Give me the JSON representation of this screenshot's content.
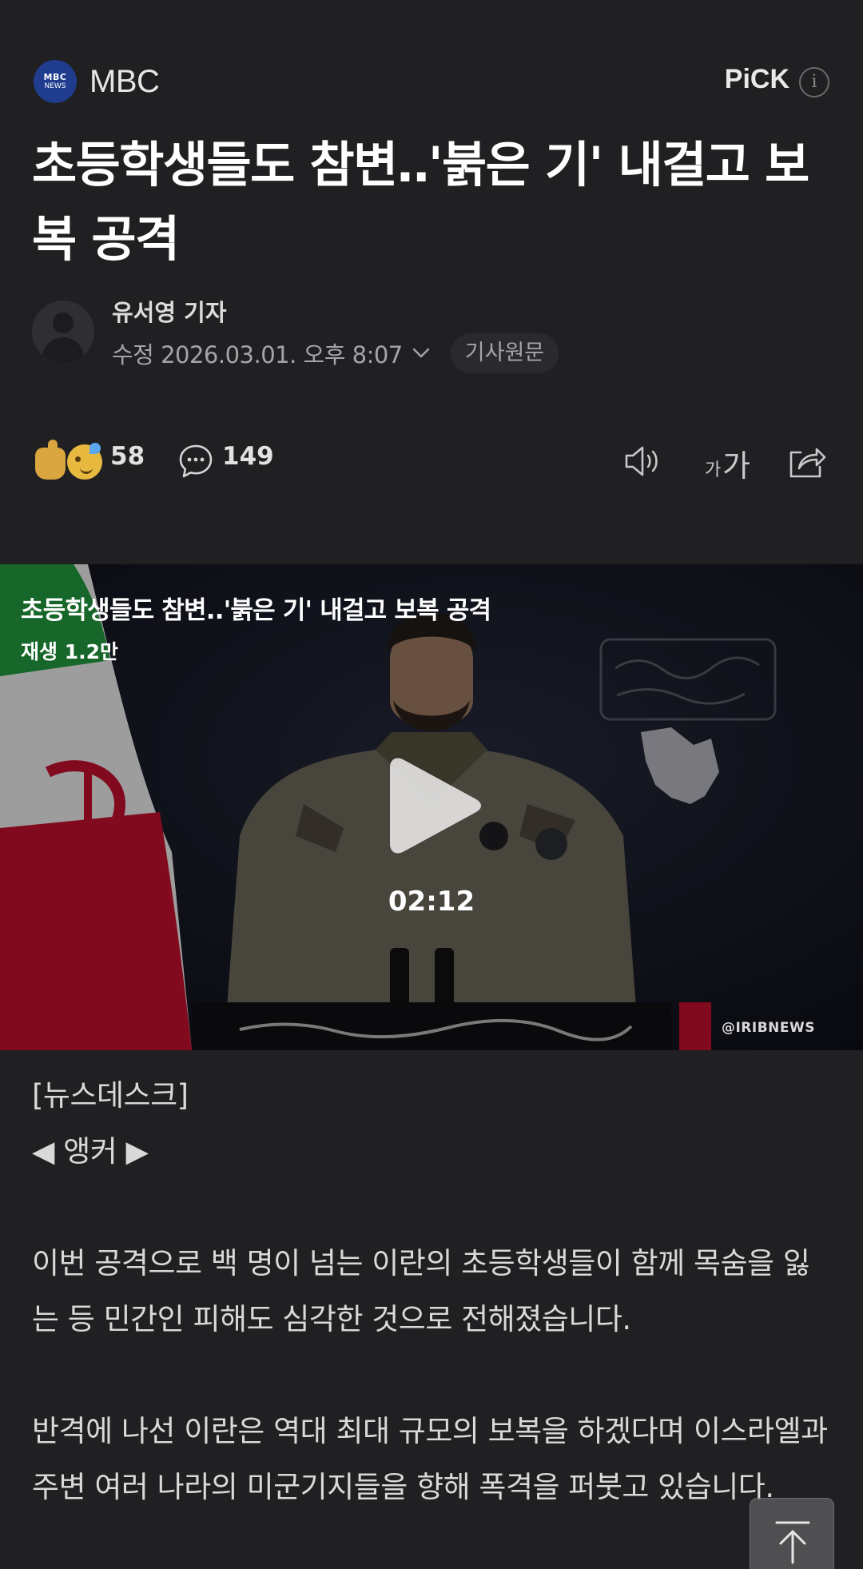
{
  "press": {
    "logo_line1": "MBC",
    "logo_line2": "NEWS",
    "name": "MBC",
    "pick_label": "PiCK",
    "info_label": "i"
  },
  "article": {
    "headline": "초등학생들도 참변‥'붉은 기' 내걸고 보복 공격",
    "reporter": "유서영 기자",
    "date": "수정 2026.03.01. 오후 8:07",
    "origin_button": "기사원문"
  },
  "reactions": {
    "like_count": "58",
    "comment_count": "149",
    "font_small": "가",
    "font_big": "가"
  },
  "video": {
    "title": "초등학생들도 참변..'붉은 기' 내걸고 보복 공격",
    "views": "재생 1.2만",
    "duration": "02:12",
    "watermark": "@IRIBNEWS"
  },
  "body": {
    "line1": "[뉴스데스크]",
    "line2": "◀ 앵커 ▶",
    "para1": "이번 공격으로 백 명이 넘는 이란의 초등학생들이 함께 목숨을 잃는 등 민간인 피해도 심각한 것으로 전해졌습니다.",
    "para2": "반격에 나선 이란은 역대 최대 규모의 보복을 하겠다며 이스라엘과 주변 여러 나라의 미군기지들을 향해 폭격을 퍼붓고 있습니다."
  },
  "colors": {
    "background": "#202022",
    "press_logo": "#1f3c8e",
    "iran_red": "#c8102e",
    "iran_green": "#239f40"
  }
}
